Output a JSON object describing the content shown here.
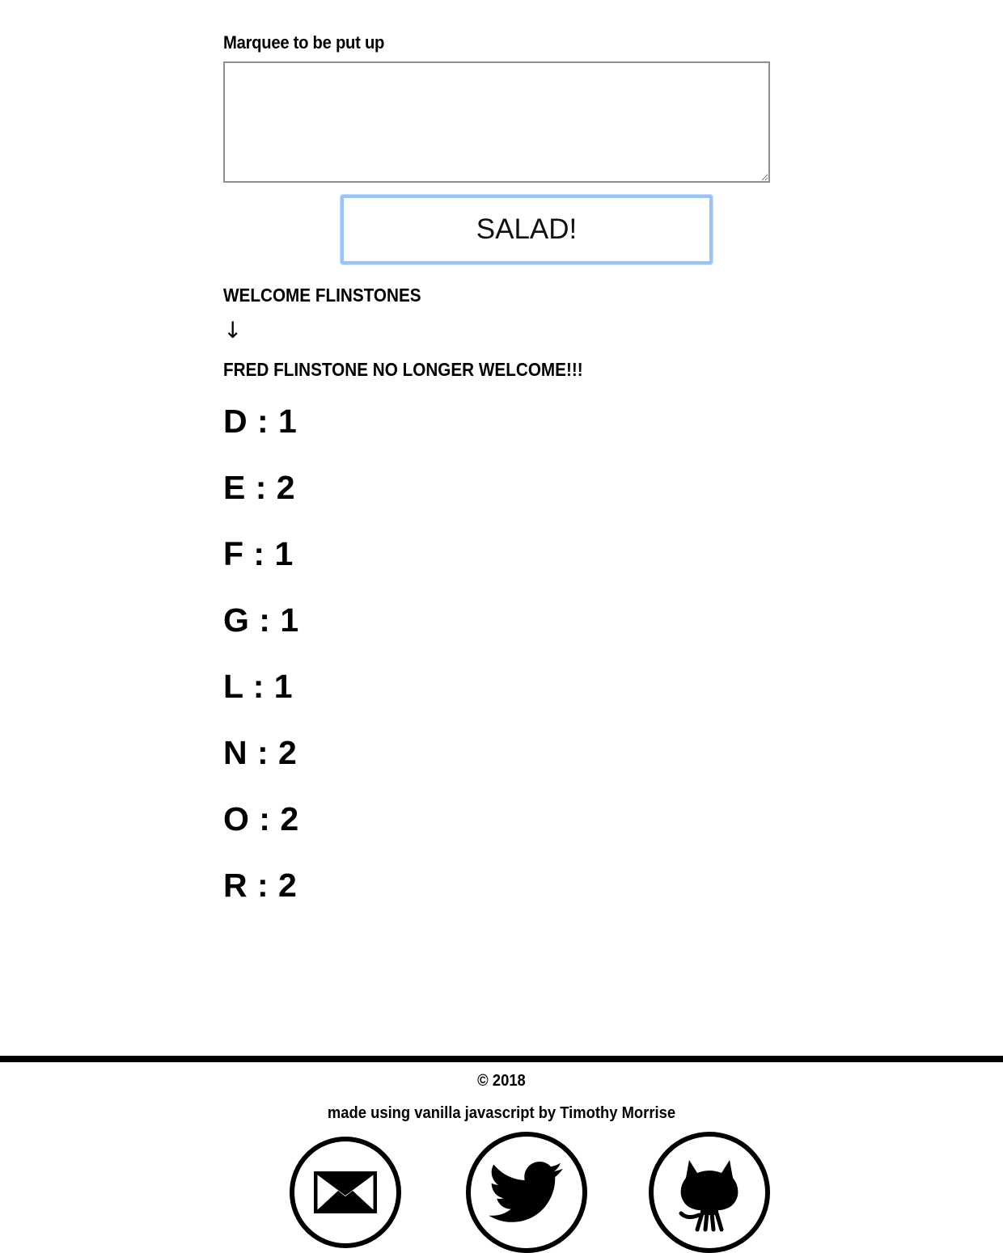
{
  "form": {
    "label": "Marquee to be put up",
    "textarea_value": "",
    "submit_label": "SALAD!"
  },
  "result": {
    "input_text": "WELCOME FLINSTONES",
    "arrow": "↓",
    "output_text": "FRED FLINSTONE NO LONGER WELCOME!!!",
    "letter_counts": [
      {
        "text": "D : 1"
      },
      {
        "text": "E : 2"
      },
      {
        "text": "F : 1"
      },
      {
        "text": "G : 1"
      },
      {
        "text": "L : 1"
      },
      {
        "text": "N : 2"
      },
      {
        "text": "O : 2"
      },
      {
        "text": "R : 2"
      }
    ]
  },
  "footer": {
    "copyright": "© 2018",
    "credit": "made using vanilla javascript by Timothy Morrise",
    "social_icons": [
      "envelope-icon",
      "twitter-bird-icon",
      "github-octocat-icon"
    ]
  }
}
